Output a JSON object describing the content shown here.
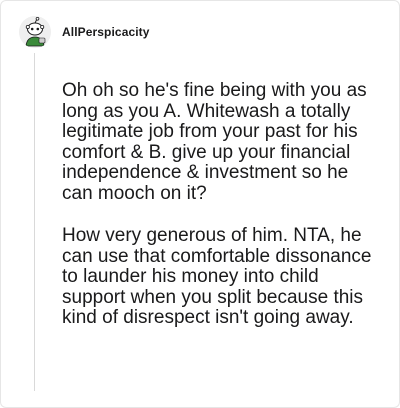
{
  "comment": {
    "username": "AllPerspicacity",
    "avatar_icon": "snoo-avatar-icon",
    "paragraphs": [
      "Oh oh so he's fine being with you as long as you A. Whitewash a totally legitimate job from your past for his comfort & B. give up your financial independence & investment so he can mooch on it?",
      "How very generous of him. NTA, he can use that comfortable dissonance to launder his money into child support when you split because this kind of disrespect isn't going away."
    ]
  },
  "colors": {
    "text": "#1a1a1b",
    "thread_line": "#d9d9d9",
    "border": "#e6e6e6",
    "avatar_shirt": "#3a8a3a"
  }
}
